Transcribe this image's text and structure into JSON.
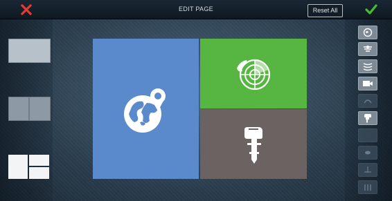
{
  "header": {
    "title": "EDIT PAGE",
    "reset_label": "Reset All",
    "close_icon": "close-x-icon",
    "accept_icon": "checkmark-icon",
    "colors": {
      "close": "#e53935",
      "accept": "#43c12c"
    }
  },
  "layout_templates": [
    {
      "name": "single-pane"
    },
    {
      "name": "two-pane-split"
    },
    {
      "name": "three-pane-split"
    }
  ],
  "panes": [
    {
      "name": "chart-pane",
      "icon": "chart-globe-icon",
      "color": "#5a8acb"
    },
    {
      "name": "radar-pane",
      "icon": "radar-icon",
      "color": "#57b541"
    },
    {
      "name": "engine-pane",
      "icon": "outboard-engine-icon",
      "color": "#6a6361"
    }
  ],
  "app_icons": [
    {
      "name": "chart-icon",
      "enabled": true
    },
    {
      "name": "sonar-icon",
      "enabled": true
    },
    {
      "name": "radar-sweep-icon",
      "enabled": true
    },
    {
      "name": "camera-icon",
      "enabled": true
    },
    {
      "name": "autopilot-icon",
      "enabled": false
    },
    {
      "name": "engine-icon",
      "enabled": true
    },
    {
      "name": "blank-app-icon",
      "enabled": false
    },
    {
      "name": "fish-finder-icon",
      "enabled": false
    },
    {
      "name": "sail-icon",
      "enabled": false
    },
    {
      "name": "gauges-icon",
      "enabled": false
    }
  ]
}
